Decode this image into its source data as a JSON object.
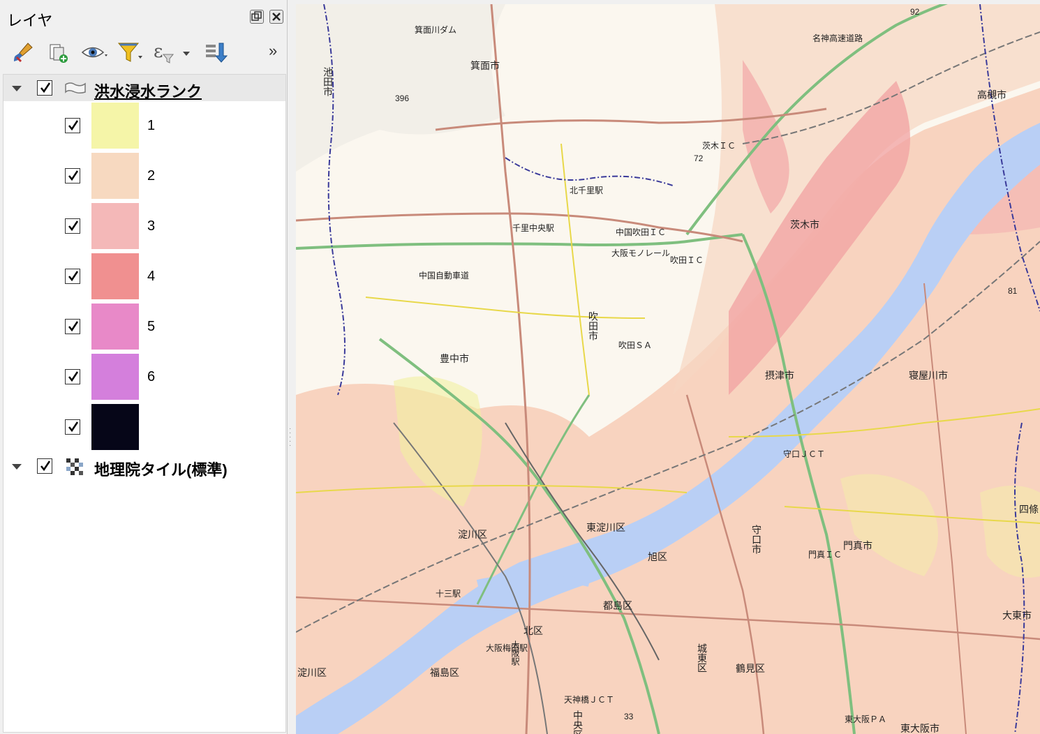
{
  "panel": {
    "title": "レイヤ",
    "more_label": "»"
  },
  "toolbar": {
    "icons": [
      "paintbrush-icon",
      "add-group-icon",
      "eye-icon",
      "filter-icon",
      "expression-filter-icon",
      "move-layers-icon"
    ]
  },
  "layers": [
    {
      "name": "洪水浸水ランク",
      "checked": true,
      "expanded": true,
      "classes": [
        {
          "label": "1",
          "color": "#f5f5a8",
          "checked": true
        },
        {
          "label": "2",
          "color": "#f7d9c0",
          "checked": true
        },
        {
          "label": "3",
          "color": "#f4b8b8",
          "checked": true
        },
        {
          "label": "4",
          "color": "#f09090",
          "checked": true
        },
        {
          "label": "5",
          "color": "#e889c8",
          "checked": true
        },
        {
          "label": "6",
          "color": "#d47fdc",
          "checked": true
        },
        {
          "label": "",
          "color": "#060618",
          "checked": true
        }
      ]
    },
    {
      "name": "地理院タイル(標準)",
      "checked": true,
      "expanded": true
    }
  ],
  "map": {
    "labels": {
      "minoh_city": "箕面市",
      "ikeda_city": "池田市",
      "toyonaka_city": "豊中市",
      "suita_city": "吹田市",
      "ibaraki_city": "茨木市",
      "takatsuki_city": "高槻市",
      "settsu_city": "摂津市",
      "neyagawa_city": "寝屋川市",
      "moriguchi_city": "守口市",
      "kadoma_city": "門真市",
      "daito_city": "大東市",
      "higashiosaka_city": "東大阪市",
      "kita_ward": "北区",
      "miyakojima_ward": "都島区",
      "asahi_ward": "旭区",
      "joto_ward": "城東区",
      "tsurumi_ward": "鶴見区",
      "higashiyodogawa_ward": "東淀川区",
      "yodogawa_ward": "淀川区",
      "fukushima_ward": "福島区",
      "chuo_ward": "中央区",
      "yodogawa_ward_west": "淀川区",
      "shijo": "四條",
      "chugoku_expressway": "中国自動車道",
      "meishin_expressway": "名神高速道路",
      "osaka_monorail": "大阪モノレール",
      "minoh_dam": "箕面川ダム",
      "chugoku_suita_ic": "中国吹田ＩＣ",
      "suita_sa": "吹田ＳＡ",
      "ibaraki_ic": "茨木ＩＣ",
      "suita_ic": "吹田ＩＣ",
      "moriguchi_jct": "守口ＪＣＴ",
      "kadoma_ic": "門真ＩＣ",
      "higashiosaka_pa": "東大阪ＰＡ",
      "senri_chuo": "千里中央駅",
      "kita_senri": "北千里駅",
      "umeda": "大阪梅田駅",
      "osaka_station": "大阪駅",
      "juso": "十三駅",
      "tenjinbashi_jct": "天神橋ＪＣＴ",
      "elev_396": "396",
      "elev_72": "72",
      "elev_92": "92",
      "elev_81": "81",
      "elev_33": "33"
    }
  }
}
